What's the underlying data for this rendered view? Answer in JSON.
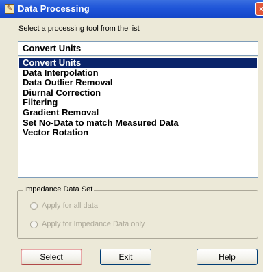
{
  "window": {
    "title": "Data Processing",
    "icon_glyph": "✎",
    "close_glyph": "×"
  },
  "instruction": "Select a processing tool from the list",
  "selected_value": "Convert Units",
  "tools": [
    "Convert Units",
    "Data Interpolation",
    "Data Outlier Removal",
    "Diurnal Correction",
    "Filtering",
    "Gradient Removal",
    "Set No-Data to match Measured Data",
    "Vector Rotation"
  ],
  "selected_index": 0,
  "impedance": {
    "legend": "Impedance Data Set",
    "option_all": "Apply for all data",
    "option_impedance": "Apply for Impedance Data only"
  },
  "buttons": {
    "select": "Select",
    "exit": "Exit",
    "help": "Help"
  },
  "colors": {
    "titlebar": "#1f55d8",
    "selection": "#0a246a",
    "dialog_bg": "#ece9d8",
    "disabled_text": "#aca899"
  }
}
